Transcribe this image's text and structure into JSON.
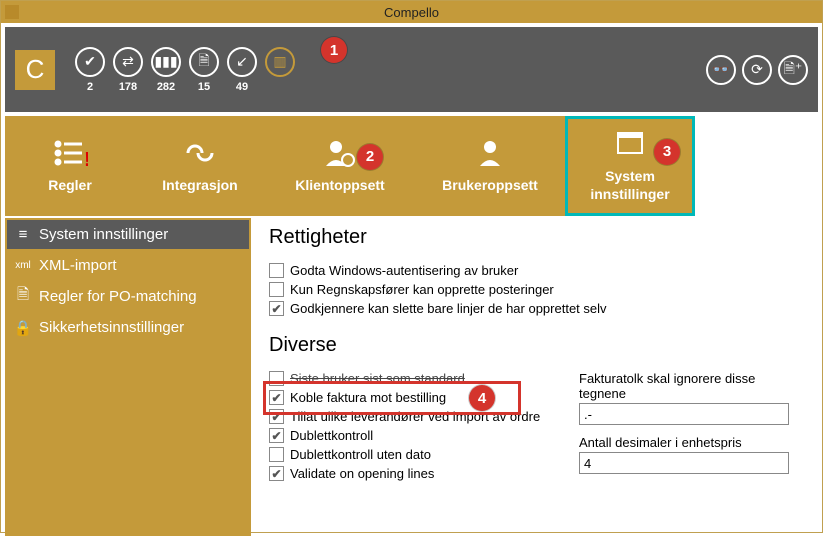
{
  "app": {
    "title": "Compello",
    "logo": "C"
  },
  "toolbar": {
    "icons": [
      {
        "glyph": "check",
        "count": "2"
      },
      {
        "glyph": "swap",
        "count": "178"
      },
      {
        "glyph": "books",
        "count": "282"
      },
      {
        "glyph": "page",
        "count": "15"
      },
      {
        "glyph": "arrow",
        "count": "49"
      },
      {
        "glyph": "bars",
        "count": "",
        "gold": true
      }
    ]
  },
  "callouts": {
    "c1": "1",
    "c2": "2",
    "c3": "3",
    "c4": "4"
  },
  "tabs": [
    {
      "label": "Regler"
    },
    {
      "label": "Integrasjon"
    },
    {
      "label": "Klientoppsett"
    },
    {
      "label": "Brukeroppsett"
    },
    {
      "label": "System\ninnstillinger"
    }
  ],
  "sidebar": [
    {
      "icon": "list",
      "label": "System innstillinger",
      "active": true
    },
    {
      "icon": "xml",
      "label": "XML-import"
    },
    {
      "icon": "doc",
      "label": "Regler for PO-matching"
    },
    {
      "icon": "lock",
      "label": "Sikkerhetsinnstillinger"
    }
  ],
  "sections": {
    "rights": {
      "heading": "Rettigheter",
      "items": [
        {
          "checked": false,
          "label": "Godta Windows-autentisering av bruker"
        },
        {
          "checked": false,
          "label": "Kun Regnskapsfører kan opprette posteringer"
        },
        {
          "checked": true,
          "label": "Godkjennere kan slette bare linjer de har opprettet selv"
        }
      ]
    },
    "diverse": {
      "heading": "Diverse",
      "left": [
        {
          "checked": false,
          "label": "Siste bruker sist som standard",
          "strike": true
        },
        {
          "checked": true,
          "label": "Koble faktura mot bestilling",
          "boxed": true
        },
        {
          "checked": true,
          "label": "Tillat ulike leverandører ved import av ordre"
        },
        {
          "checked": true,
          "label": "Dublettkontroll"
        },
        {
          "checked": false,
          "label": "Dublettkontroll uten dato"
        },
        {
          "checked": true,
          "label": "Validate on opening lines"
        }
      ],
      "right": {
        "f1_label": "Fakturatolk skal ignorere disse tegnene",
        "f1_value": ".-",
        "f2_label": "Antall desimaler i enhetspris",
        "f2_value": "4"
      }
    }
  }
}
